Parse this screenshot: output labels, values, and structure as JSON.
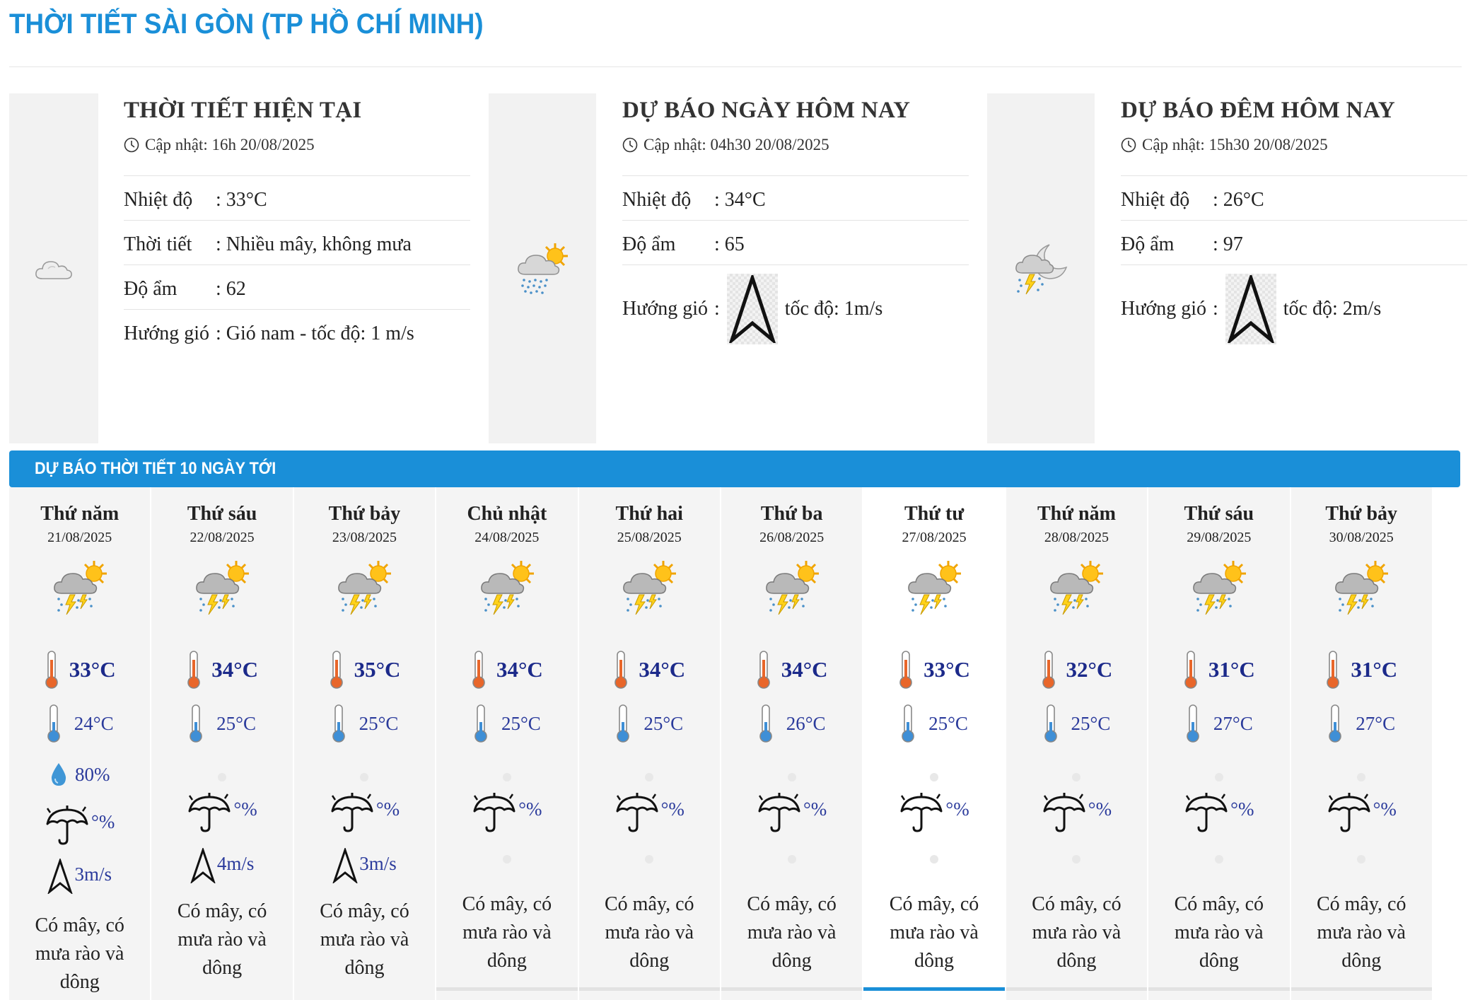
{
  "page_title": "THỜI TIẾT SÀI GÒN (TP HỒ CHÍ MINH)",
  "cards": [
    {
      "title": "THỜI TIẾT HIỆN TẠI",
      "update": "Cập nhật: 16h 20/08/2025",
      "icon": "cloud-icon",
      "rows": [
        {
          "label": "Nhiệt độ",
          "value": ": 33°C"
        },
        {
          "label": "Thời tiết",
          "value": ": Nhiều mây, không mưa"
        },
        {
          "label": "Độ ẩm",
          "value": ": 62"
        },
        {
          "label": "Hướng gió",
          "value": ": Gió nam - tốc độ: 1 m/s"
        }
      ]
    },
    {
      "title": "DỰ BÁO NGÀY HÔM NAY",
      "update": "Cập nhật: 04h30 20/08/2025",
      "icon": "sun-cloud-rain-icon",
      "rows": [
        {
          "label": "Nhiệt độ",
          "value": ": 34°C"
        },
        {
          "label": "Độ ẩm",
          "value": ": 65"
        }
      ],
      "wind_label": "Hướng gió",
      "wind_colon": ":",
      "wind_speed": "tốc độ: 1m/s"
    },
    {
      "title": "DỰ BÁO ĐÊM HÔM NAY",
      "update": "Cập nhật: 15h30 20/08/2025",
      "icon": "moon-cloud-storm-icon",
      "rows": [
        {
          "label": "Nhiệt độ",
          "value": ": 26°C"
        },
        {
          "label": "Độ ẩm",
          "value": ": 97"
        }
      ],
      "wind_label": "Hướng gió",
      "wind_colon": ":",
      "wind_speed": "tốc độ: 2m/s"
    }
  ],
  "forecast_header": "DỰ BÁO THỜI TIẾT 10 NGÀY TỚI",
  "forecast": [
    {
      "name": "Thứ năm",
      "date": "21/08/2025",
      "max": "33°C",
      "min": "24°C",
      "humidity": "80%",
      "rain": "°%",
      "wind": "3m/s",
      "desc": "Có mây, có mưa rào và dông"
    },
    {
      "name": "Thứ sáu",
      "date": "22/08/2025",
      "max": "34°C",
      "min": "25°C",
      "humidity": "",
      "rain": "°%",
      "wind": "4m/s",
      "desc": "Có mây, có mưa rào và dông"
    },
    {
      "name": "Thứ bảy",
      "date": "23/08/2025",
      "max": "35°C",
      "min": "25°C",
      "humidity": "",
      "rain": "°%",
      "wind": "3m/s",
      "desc": "Có mây, có mưa rào và dông"
    },
    {
      "name": "Chủ nhật",
      "date": "24/08/2025",
      "max": "34°C",
      "min": "25°C",
      "humidity": "",
      "rain": "°%",
      "wind": "",
      "desc": "Có mây, có mưa rào và dông"
    },
    {
      "name": "Thứ hai",
      "date": "25/08/2025",
      "max": "34°C",
      "min": "25°C",
      "humidity": "",
      "rain": "°%",
      "wind": "",
      "desc": "Có mây, có mưa rào và dông"
    },
    {
      "name": "Thứ ba",
      "date": "26/08/2025",
      "max": "34°C",
      "min": "26°C",
      "humidity": "",
      "rain": "°%",
      "wind": "",
      "desc": "Có mây, có mưa rào và dông"
    },
    {
      "name": "Thứ tư",
      "date": "27/08/2025",
      "max": "33°C",
      "min": "25°C",
      "humidity": "",
      "rain": "°%",
      "wind": "",
      "desc": "Có mây, có mưa rào và dông"
    },
    {
      "name": "Thứ năm",
      "date": "28/08/2025",
      "max": "32°C",
      "min": "25°C",
      "humidity": "",
      "rain": "°%",
      "wind": "",
      "desc": "Có mây, có mưa rào và dông"
    },
    {
      "name": "Thứ sáu",
      "date": "29/08/2025",
      "max": "31°C",
      "min": "27°C",
      "humidity": "",
      "rain": "°%",
      "wind": "",
      "desc": "Có mây, có mưa rào và dông"
    },
    {
      "name": "Thứ bảy",
      "date": "30/08/2025",
      "max": "31°C",
      "min": "27°C",
      "humidity": "",
      "rain": "°%",
      "wind": "",
      "desc": "Có mây, có mưa rào và dông"
    }
  ],
  "selected_day_index": 6,
  "colors": {
    "accent": "#1a8fd8",
    "temp_text": "#1c2a8a",
    "panel_bg": "#f4f4f4"
  }
}
